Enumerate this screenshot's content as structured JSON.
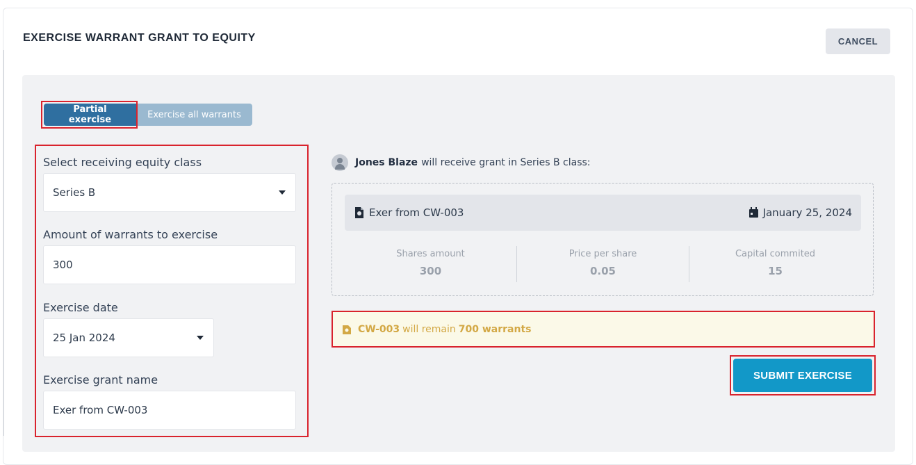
{
  "header": {
    "title": "EXERCISE WARRANT GRANT TO EQUITY",
    "cancel_label": "CANCEL"
  },
  "mode_toggle": {
    "options": [
      "Partial exercise",
      "Exercise all warrants"
    ],
    "selected": "Partial exercise"
  },
  "form": {
    "equity_class": {
      "label": "Select receiving equity class",
      "value": "Series B"
    },
    "amount": {
      "label": "Amount of warrants to exercise",
      "value": "300"
    },
    "exercise_date": {
      "label": "Exercise date",
      "value": "25 Jan 2024"
    },
    "grant_name": {
      "label": "Exercise grant name",
      "value": "Exer from CW-003"
    }
  },
  "summary": {
    "recipient_name": "Jones Blaze",
    "recipient_text": "will receive grant in Series B class:",
    "grant_name": "Exer from CW-003",
    "grant_date": "January 25, 2024",
    "stats": [
      {
        "label": "Shares amount",
        "value": "300"
      },
      {
        "label": "Price per share",
        "value": "0.05"
      },
      {
        "label": "Capital commited",
        "value": "15"
      }
    ]
  },
  "remaining": {
    "warrant_id": "CW-003",
    "mid_text": "will remain",
    "amount_text": "700 warrants"
  },
  "actions": {
    "submit_label": "SUBMIT EXERCISE"
  },
  "colors": {
    "primary": "#1298c8",
    "toggle_active": "#2f6fa0",
    "toggle_inactive": "#9ab9d0",
    "warning_text": "#d3a845",
    "highlight": "#d9232d"
  },
  "icons": {
    "grant": "document-certificate-icon",
    "date": "calendar-icon",
    "avatar": "user-avatar-icon",
    "warning": "warrant-icon"
  }
}
